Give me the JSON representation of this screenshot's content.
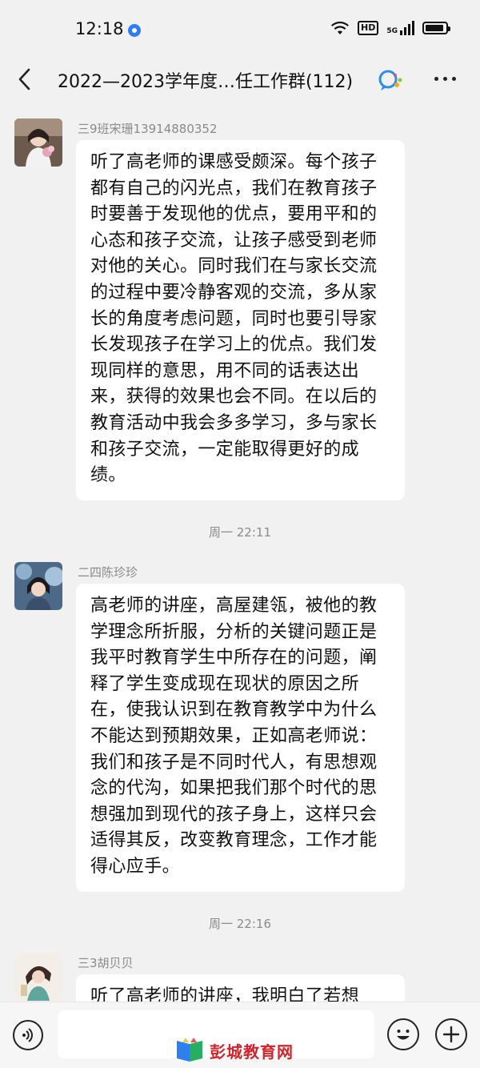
{
  "status_bar": {
    "time": "12:18",
    "network": "5G",
    "hd_label": "HD"
  },
  "header": {
    "title": "2022—2023学年度…任工作群(112)",
    "back_icon": "chevron-left-icon",
    "more_icon": "more-dots-icon"
  },
  "messages": [
    {
      "sender": "三9班宋珊13914880352",
      "text": "听了高老师的课感受颇深。每个孩子都有自己的闪光点，我们在教育孩子时要善于发现他的优点，要用平和的心态和孩子交流，让孩子感受到老师对他的关心。同时我们在与家长交流的过程中要冷静客观的交流，多从家长的角度考虑问题，同时也要引导家长发现孩子在学习上的优点。我们发现同样的意思，用不同的话表达出来，获得的效果也会不同。在以后的教育活动中我会多多学习，多与家长和孩子交流，一定能取得更好的成绩。"
    },
    {
      "sender": "二四陈珍珍",
      "text": "高老师的讲座，高屋建瓴，被他的教学理念所折服，分析的关键问题正是我平时教育学生中所存在的问题，阐释了学生变成现在现状的原因之所在，使我认识到在教育教学中为什么不能达到预期效果，正如高老师说：我们和孩子是不同时代人，有思想观念的代沟，如果把我们那个时代的思想强加到现代的孩子身上，这样只会适得其反，改变教育理念，工作才能得心应手。"
    },
    {
      "sender": "三3胡贝贝",
      "text": "听了高老师的讲座，我明白了若想"
    }
  ],
  "timestamps": [
    "周一 22:11",
    "周一 22:16"
  ],
  "bottom_bar": {
    "watermark": "彭城教育网",
    "voice_icon": "voice-icon",
    "emoji_icon": "emoji-icon",
    "plus_icon": "plus-icon"
  },
  "colors": {
    "background": "#f1f1f1",
    "bubble": "#ffffff",
    "meta_text": "#8a8a8a",
    "watermark": "#d4232a",
    "notif_blue": "#2f7cf6"
  }
}
